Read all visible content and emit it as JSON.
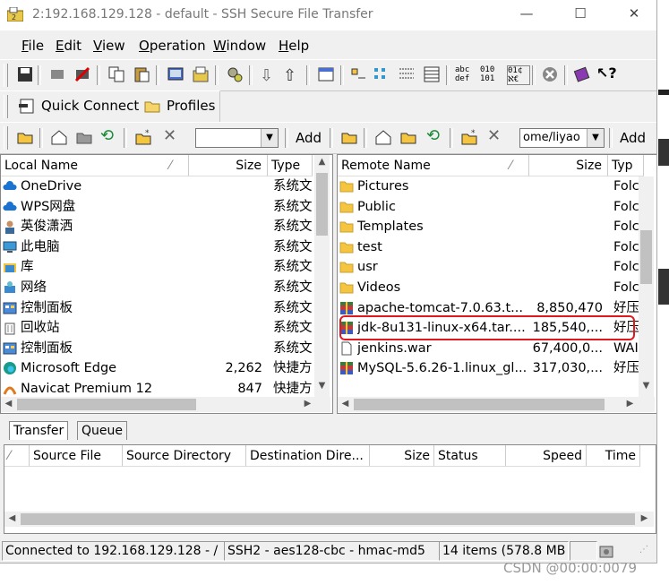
{
  "window": {
    "title": "2:192.168.129.128 - default - SSH Secure File Transfer"
  },
  "menu": [
    {
      "label": "File",
      "u": "F",
      "rest": "ile"
    },
    {
      "label": "Edit",
      "u": "E",
      "rest": "dit"
    },
    {
      "label": "View",
      "u": "V",
      "rest": "iew"
    },
    {
      "label": "Operation",
      "u": "O",
      "rest": "peration"
    },
    {
      "label": "Window",
      "u": "W",
      "rest": "indow"
    },
    {
      "label": "Help",
      "u": "H",
      "rest": "elp"
    }
  ],
  "toolbar2": {
    "quick_connect": "Quick Connect",
    "profiles": "Profiles"
  },
  "toolbar3": {
    "local_add": "Add",
    "remote_path": "ome/liyao",
    "remote_add": "Add"
  },
  "local": {
    "columns": [
      "Local Name",
      "Size",
      "Type"
    ],
    "rows": [
      {
        "name": "OneDrive",
        "size": "",
        "type": "系统文",
        "icon": "cloud"
      },
      {
        "name": "WPS网盘",
        "size": "",
        "type": "系统文",
        "icon": "cloud"
      },
      {
        "name": "英俊潇洒",
        "size": "",
        "type": "系统文",
        "icon": "user"
      },
      {
        "name": "此电脑",
        "size": "",
        "type": "系统文",
        "icon": "pc"
      },
      {
        "name": "库",
        "size": "",
        "type": "系统文",
        "icon": "lib"
      },
      {
        "name": "网络",
        "size": "",
        "type": "系统文",
        "icon": "net"
      },
      {
        "name": "控制面板",
        "size": "",
        "type": "系统文",
        "icon": "panel"
      },
      {
        "name": "回收站",
        "size": "",
        "type": "系统文",
        "icon": "bin"
      },
      {
        "name": "控制面板",
        "size": "",
        "type": "系统文",
        "icon": "panel"
      },
      {
        "name": "Microsoft Edge",
        "size": "2,262",
        "type": "快捷方",
        "icon": "edge"
      },
      {
        "name": "Navicat Premium 12",
        "size": "847",
        "type": "快捷方",
        "icon": "navicat"
      }
    ]
  },
  "remote": {
    "columns": [
      "Remote Name",
      "Size",
      "Typ"
    ],
    "rows": [
      {
        "name": "Pictures",
        "size": "",
        "type": "Folc",
        "icon": "folder"
      },
      {
        "name": "Public",
        "size": "",
        "type": "Folc",
        "icon": "folder"
      },
      {
        "name": "Templates",
        "size": "",
        "type": "Folc",
        "icon": "folder"
      },
      {
        "name": "test",
        "size": "",
        "type": "Folc",
        "icon": "folder"
      },
      {
        "name": "usr",
        "size": "",
        "type": "Folc",
        "icon": "folder"
      },
      {
        "name": "Videos",
        "size": "",
        "type": "Folc",
        "icon": "folder"
      },
      {
        "name": "apache-tomcat-7.0.63.t...",
        "size": "8,850,470",
        "type": "好压",
        "icon": "archive"
      },
      {
        "name": "jdk-8u131-linux-x64.tar....",
        "size": "185,540,...",
        "type": "好压",
        "icon": "archive",
        "highlight": true
      },
      {
        "name": "jenkins.war",
        "size": "67,400,0...",
        "type": "WAI",
        "icon": "file"
      },
      {
        "name": "MySQL-5.6.26-1.linux_gl...",
        "size": "317,030,...",
        "type": "好压",
        "icon": "archive"
      }
    ]
  },
  "tabs": [
    "Transfer",
    "Queue"
  ],
  "transfer_columns": [
    "Source File",
    "Source Directory",
    "Destination Dire...",
    "Size",
    "Status",
    "Speed",
    "Time"
  ],
  "status": {
    "connection": "Connected to 192.168.129.128 - /",
    "cipher": "SSH2 - aes128-cbc - hmac-md5",
    "items": "14 items (578.8 MB"
  },
  "watermark": "CSDN @00:00:0079",
  "colors": {
    "highlight_box": "#e0191e",
    "folder": "#f5c542",
    "archive": "#3a7a3a"
  }
}
